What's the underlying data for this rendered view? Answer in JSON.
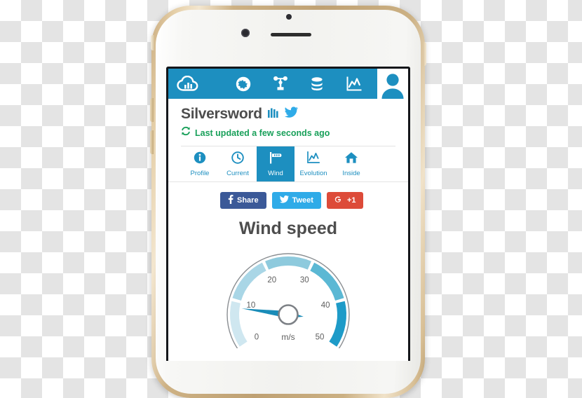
{
  "device": {
    "name": "smartphone-mockup",
    "bezel_color": "#c9ab7e"
  },
  "top_nav": {
    "brand_icon": "cloud-chart-logo-icon",
    "background": "#1d8fc0",
    "items": [
      {
        "icon": "globe-icon",
        "name": "map"
      },
      {
        "icon": "anemometer-icon",
        "name": "stations"
      },
      {
        "icon": "database-icon",
        "name": "data"
      },
      {
        "icon": "line-chart-icon",
        "name": "graphs"
      }
    ],
    "avatar_icon": "user-avatar-icon"
  },
  "station": {
    "name": "Silversword",
    "bars_icon": "bar-chart-icon",
    "twitter_icon": "twitter-bird-icon",
    "refresh_icon": "refresh-icon",
    "update_text": "Last updated a few seconds ago",
    "update_color": "#19a05a"
  },
  "tabs": [
    {
      "label": "Profile",
      "icon": "info-circle-icon",
      "active": false
    },
    {
      "label": "Current",
      "icon": "clock-icon",
      "active": false
    },
    {
      "label": "Wind",
      "icon": "windsock-icon",
      "active": true
    },
    {
      "label": "Evolution",
      "icon": "line-chart-icon",
      "active": false
    },
    {
      "label": "Inside",
      "icon": "home-icon",
      "active": false
    }
  ],
  "social": [
    {
      "label": "Share",
      "icon": "facebook-f-icon",
      "color": "#3b5998"
    },
    {
      "label": "Tweet",
      "icon": "twitter-bird-icon",
      "color": "#2fabe8"
    },
    {
      "label": "+1",
      "icon": "google-plus-icon",
      "color": "#dd4b39"
    }
  ],
  "chart_data": {
    "type": "gauge",
    "title": "Wind speed",
    "unit": "m/s",
    "value": 8.5,
    "min": 0,
    "max": 50,
    "ticks": [
      0,
      10,
      20,
      30,
      40,
      50
    ],
    "tick_labels": [
      "0",
      "10",
      "20",
      "30",
      "40",
      "50"
    ],
    "start_angle_deg": 215,
    "end_angle_deg": -35,
    "bands": [
      {
        "from": 0,
        "to": 10,
        "color": "#cfe7f0"
      },
      {
        "from": 10,
        "to": 20,
        "color": "#a9d6e6"
      },
      {
        "from": 20,
        "to": 30,
        "color": "#8ecadd"
      },
      {
        "from": 30,
        "to": 40,
        "color": "#5bb8d4"
      },
      {
        "from": 40,
        "to": 50,
        "color": "#1e9bc8"
      }
    ],
    "needle_color": "#1a8cb8",
    "hub_ring_color": "#7d8186",
    "outer_ring_color": "#8a8e92",
    "label_color": "#5e5e5e"
  }
}
